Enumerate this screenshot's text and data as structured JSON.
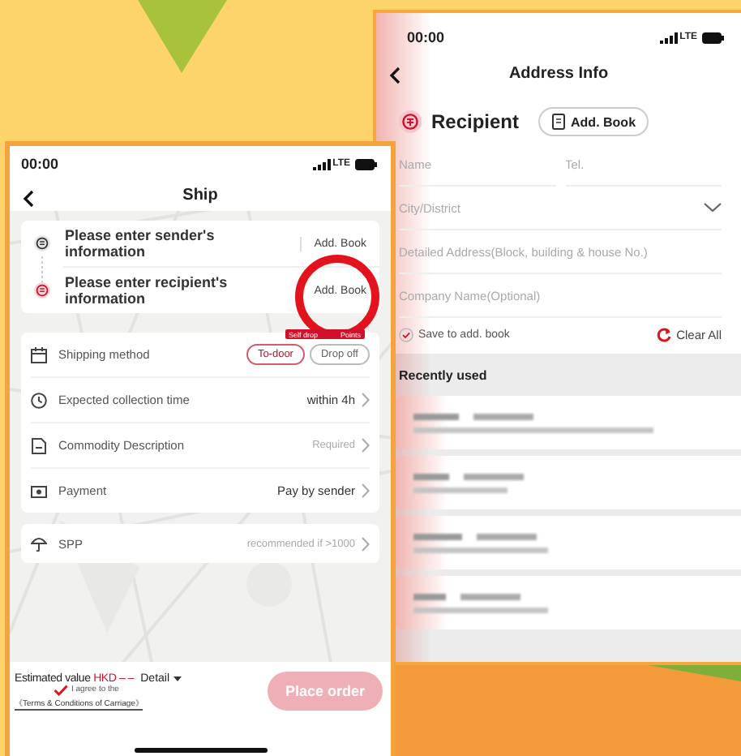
{
  "ship_screen": {
    "status_time": "00:00",
    "network": "LTE",
    "title": "Ship",
    "parties": [
      {
        "kind": "sender",
        "text": "Please enter sender's information",
        "action": "Add. Book"
      },
      {
        "kind": "recipient",
        "text": "Please enter recipient's information",
        "action": "Add. Book"
      }
    ],
    "tag_parts": [
      "Self drop",
      "Points"
    ],
    "options": [
      {
        "kind": "calendar",
        "label": "Shipping method",
        "choices": [
          {
            "label": "To-door",
            "selected": true
          },
          {
            "label": "Drop off",
            "selected": false
          }
        ]
      },
      {
        "kind": "clock",
        "label": "Expected collection time",
        "value": "within 4h",
        "muted": false
      },
      {
        "kind": "document",
        "label": "Commodity Description",
        "value": "Required",
        "muted": true
      },
      {
        "kind": "cash",
        "label": "Payment",
        "value": "Pay by sender",
        "muted": false
      }
    ],
    "spp": {
      "label": "SPP",
      "value": "recommended if >1000"
    },
    "footer": {
      "estimate_label": "Estimated value",
      "currency": "HKD",
      "amount": "– –",
      "detail": "Detail",
      "agree_checked": true,
      "agree_text": "I agree to the",
      "terms": "《Terms & Conditions of Carriage》",
      "order_button": "Place order",
      "order_enabled": false
    }
  },
  "address_screen": {
    "status_time": "00:00",
    "network": "LTE",
    "title": "Address Info",
    "section": "Recipient",
    "book_button": "Add. Book",
    "fields": [
      {
        "kind": "half",
        "placeholder": "Name"
      },
      {
        "kind": "half",
        "placeholder": "Tel."
      },
      {
        "kind": "dropdown",
        "placeholder": "City/District"
      },
      {
        "kind": "text",
        "placeholder": "Detailed Address(Block, building & house No.)"
      },
      {
        "kind": "text",
        "placeholder": "Company Name(Optional)"
      }
    ],
    "save_to_book": {
      "label": "Save to add. book",
      "checked": true
    },
    "clear_all": "Clear All",
    "recent_title": "Recently used",
    "recent_entries": [
      {
        "kind": "blurred"
      },
      {
        "kind": "blurred"
      },
      {
        "kind": "blurred"
      },
      {
        "kind": "blurred"
      }
    ]
  }
}
